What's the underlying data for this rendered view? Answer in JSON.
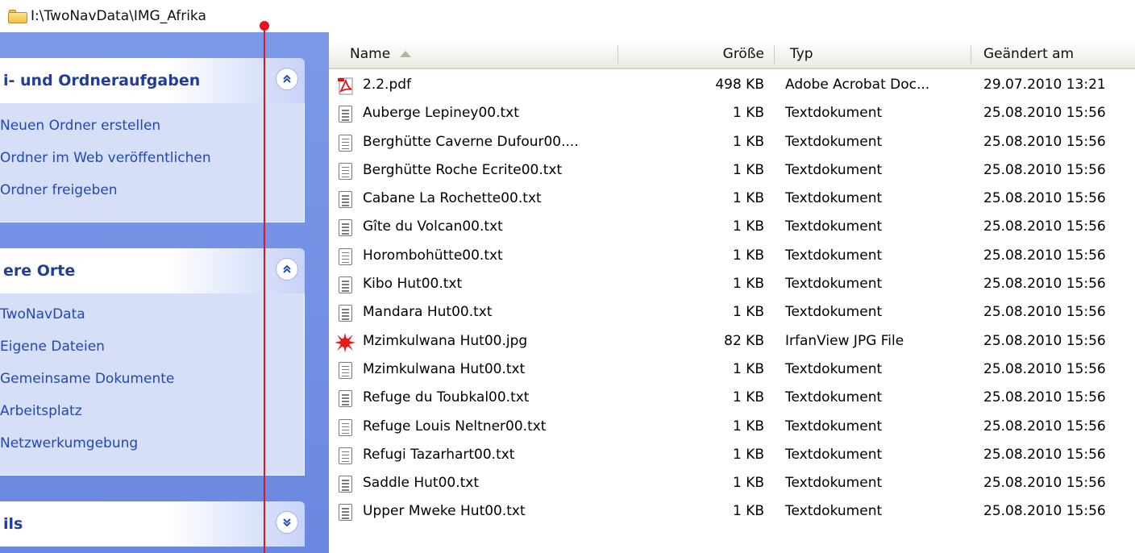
{
  "address": {
    "path": "I:\\TwoNavData\\IMG_Afrika"
  },
  "taskpane": {
    "panels": [
      {
        "title": "i- und Ordneraufgaben",
        "toggle": "collapse",
        "links": [
          "Neuen Ordner erstellen",
          "Ordner im Web veröffentlichen",
          "Ordner freigeben"
        ]
      },
      {
        "title": "ere Orte",
        "toggle": "collapse",
        "links": [
          "TwoNavData",
          "Eigene Dateien",
          "Gemeinsame Dokumente",
          "Arbeitsplatz",
          "Netzwerkumgebung"
        ]
      },
      {
        "title": "ils",
        "toggle": "expand",
        "links": []
      }
    ]
  },
  "listview": {
    "columns": {
      "name": "Name",
      "size": "Größe",
      "type": "Typ",
      "date": "Geändert am"
    },
    "sort": {
      "column": "name",
      "direction": "ascending"
    },
    "files": [
      {
        "icon": "pdf-icon",
        "name": "2.2.pdf",
        "size": "498 KB",
        "type": "Adobe Acrobat Doc...",
        "date": "29.07.2010 13:21"
      },
      {
        "icon": "text-file-icon",
        "name": "Auberge Lepiney00.txt",
        "size": "1 KB",
        "type": "Textdokument",
        "date": "25.08.2010 15:56"
      },
      {
        "icon": "text-file-icon",
        "name": "Berghütte Caverne Dufour00....",
        "size": "1 KB",
        "type": "Textdokument",
        "date": "25.08.2010 15:56"
      },
      {
        "icon": "text-file-icon",
        "name": "Berghütte Roche Ecrite00.txt",
        "size": "1 KB",
        "type": "Textdokument",
        "date": "25.08.2010 15:56"
      },
      {
        "icon": "text-file-icon",
        "name": "Cabane La Rochette00.txt",
        "size": "1 KB",
        "type": "Textdokument",
        "date": "25.08.2010 15:56"
      },
      {
        "icon": "text-file-icon",
        "name": "Gîte du Volcan00.txt",
        "size": "1 KB",
        "type": "Textdokument",
        "date": "25.08.2010 15:56"
      },
      {
        "icon": "text-file-icon",
        "name": "Horombohütte00.txt",
        "size": "1 KB",
        "type": "Textdokument",
        "date": "25.08.2010 15:56"
      },
      {
        "icon": "text-file-icon",
        "name": "Kibo Hut00.txt",
        "size": "1 KB",
        "type": "Textdokument",
        "date": "25.08.2010 15:56"
      },
      {
        "icon": "text-file-icon",
        "name": "Mandara Hut00.txt",
        "size": "1 KB",
        "type": "Textdokument",
        "date": "25.08.2010 15:56"
      },
      {
        "icon": "irfanview-jpg-icon",
        "name": "Mzimkulwana Hut00.jpg",
        "size": "82 KB",
        "type": "IrfanView JPG File",
        "date": "25.08.2010 15:56"
      },
      {
        "icon": "text-file-icon",
        "name": "Mzimkulwana Hut00.txt",
        "size": "1 KB",
        "type": "Textdokument",
        "date": "25.08.2010 15:56"
      },
      {
        "icon": "text-file-icon",
        "name": "Refuge du Toubkal00.txt",
        "size": "1 KB",
        "type": "Textdokument",
        "date": "25.08.2010 15:56"
      },
      {
        "icon": "text-file-icon",
        "name": "Refuge Louis Neltner00.txt",
        "size": "1 KB",
        "type": "Textdokument",
        "date": "25.08.2010 15:56"
      },
      {
        "icon": "text-file-icon",
        "name": "Refugi Tazarhart00.txt",
        "size": "1 KB",
        "type": "Textdokument",
        "date": "25.08.2010 15:56"
      },
      {
        "icon": "text-file-icon",
        "name": "Saddle Hut00.txt",
        "size": "1 KB",
        "type": "Textdokument",
        "date": "25.08.2010 15:56"
      },
      {
        "icon": "text-file-icon",
        "name": "Upper Mweke Hut00.txt",
        "size": "1 KB",
        "type": "Textdokument",
        "date": "25.08.2010 15:56"
      }
    ]
  },
  "colors": {
    "taskpane_bg": "#7b98e8",
    "panel_title": "#223c9c",
    "panel_link": "#2148b8",
    "annotation_line": "#e0151f"
  }
}
